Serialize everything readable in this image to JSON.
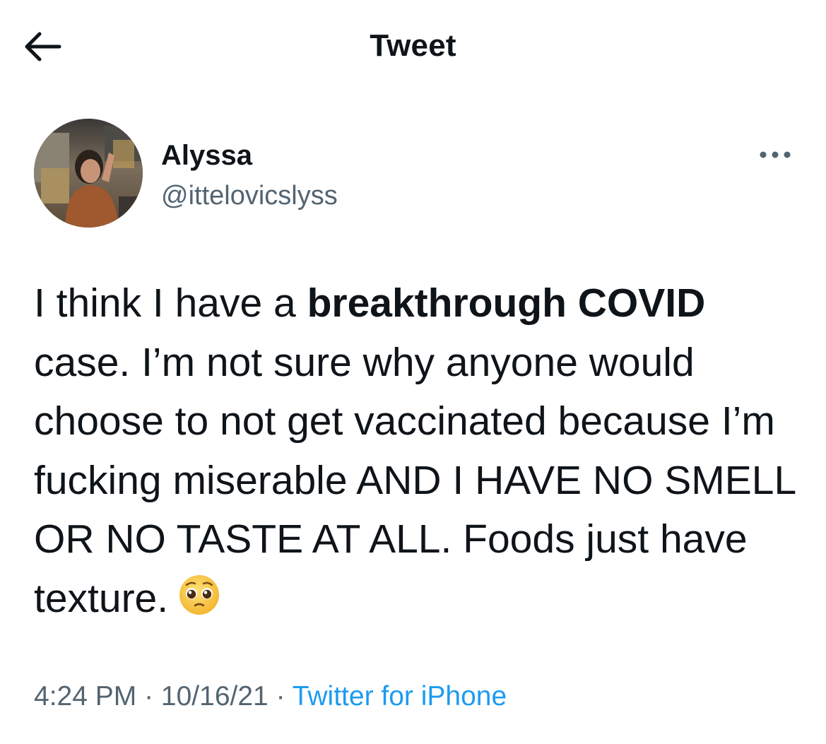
{
  "header": {
    "title": "Tweet",
    "back_icon": "arrow-left-icon"
  },
  "author": {
    "name": "Alyssa",
    "handle": "@ittelovicslyss",
    "more_icon": "more-horizontal-icon"
  },
  "tweet": {
    "text_part_1": "I think I have a ",
    "text_bold": "breakthrough COVID",
    "text_part_2": " case. I’m not sure why anyone would choose to not get vaccinated because I’m fucking miserable AND I HAVE NO SMELL OR NO TASTE AT ALL. Foods just have texture.",
    "emoji": "pleading-face-emoji"
  },
  "meta": {
    "time": "4:24 PM",
    "separator_1": " · ",
    "date": "10/16/21",
    "separator_2": " · ",
    "source": "Twitter for iPhone"
  },
  "colors": {
    "text_primary": "#0f1419",
    "text_secondary": "#536471",
    "link": "#1d9bf0",
    "background": "#ffffff"
  }
}
